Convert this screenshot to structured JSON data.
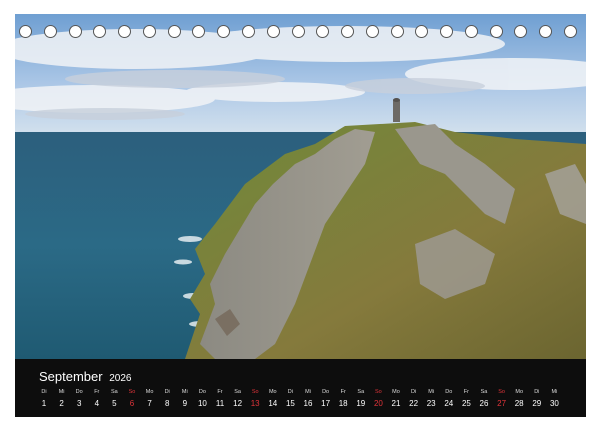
{
  "calendar": {
    "month": "September",
    "year": "2026",
    "days": [
      {
        "wd": "Di",
        "num": "1"
      },
      {
        "wd": "Mi",
        "num": "2"
      },
      {
        "wd": "Do",
        "num": "3"
      },
      {
        "wd": "Fr",
        "num": "4"
      },
      {
        "wd": "Sa",
        "num": "5"
      },
      {
        "wd": "So",
        "num": "6",
        "sunday": true
      },
      {
        "wd": "Mo",
        "num": "7"
      },
      {
        "wd": "Di",
        "num": "8"
      },
      {
        "wd": "Mi",
        "num": "9"
      },
      {
        "wd": "Do",
        "num": "10"
      },
      {
        "wd": "Fr",
        "num": "11"
      },
      {
        "wd": "Sa",
        "num": "12"
      },
      {
        "wd": "So",
        "num": "13",
        "sunday": true
      },
      {
        "wd": "Mo",
        "num": "14"
      },
      {
        "wd": "Di",
        "num": "15"
      },
      {
        "wd": "Mi",
        "num": "16"
      },
      {
        "wd": "Do",
        "num": "17"
      },
      {
        "wd": "Fr",
        "num": "18"
      },
      {
        "wd": "Sa",
        "num": "19"
      },
      {
        "wd": "So",
        "num": "20",
        "sunday": true
      },
      {
        "wd": "Mo",
        "num": "21"
      },
      {
        "wd": "Di",
        "num": "22"
      },
      {
        "wd": "Mi",
        "num": "23"
      },
      {
        "wd": "Do",
        "num": "24"
      },
      {
        "wd": "Fr",
        "num": "25"
      },
      {
        "wd": "Sa",
        "num": "26"
      },
      {
        "wd": "So",
        "num": "27",
        "sunday": true
      },
      {
        "wd": "Mo",
        "num": "28"
      },
      {
        "wd": "Di",
        "num": "29"
      },
      {
        "wd": "Mi",
        "num": "30"
      }
    ]
  },
  "binding": {
    "ring_count": 23
  },
  "colors": {
    "bar_background": "#0d0d0d",
    "sunday": "#e0343a",
    "weekday": "#ffffff"
  }
}
